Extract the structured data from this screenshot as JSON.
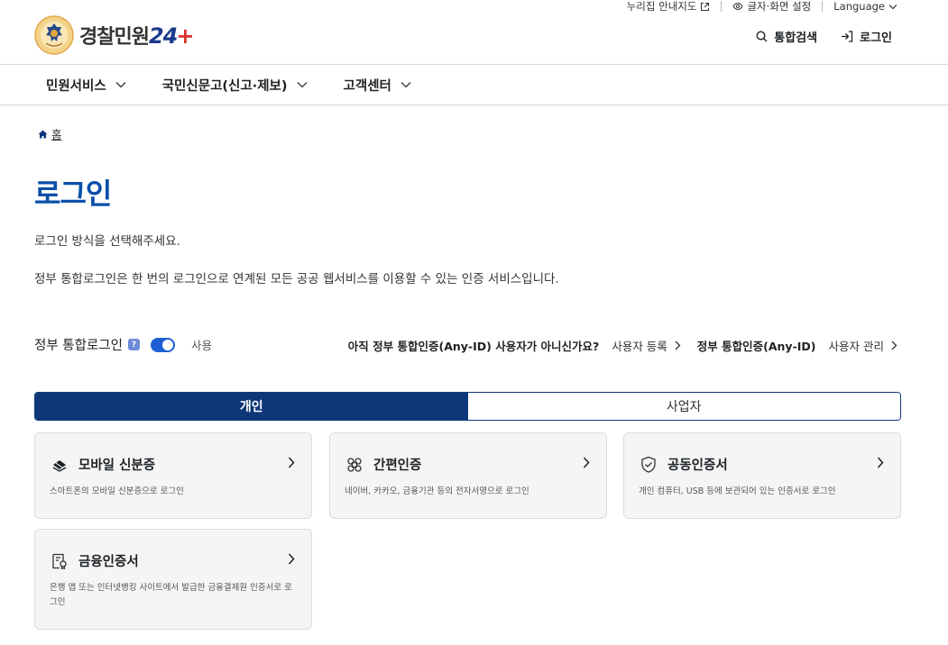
{
  "util": {
    "sitemap": "누리집 안내지도",
    "display": "글자·화면 설정",
    "language": "Language"
  },
  "header": {
    "logo_text": "경찰민원",
    "logo_num": "24",
    "search": "통합검색",
    "login": "로그인"
  },
  "gnb": [
    "민원서비스",
    "국민신문고(신고·제보)",
    "고객센터"
  ],
  "breadcrumb": {
    "home": "홈"
  },
  "page": {
    "title": "로그인",
    "desc1": "로그인 방식을 선택해주세요.",
    "desc2": "정부 통합로그인은 한 번의 로그인으로 연계된 모든 공공 웹서비스를 이용할 수 있는 인증 서비스입니다."
  },
  "integ": {
    "label": "정부 통합로그인",
    "help": "?",
    "toggle_label": "사용",
    "question": "아직 정부 통합인증(Any-ID) 사용자가 아니신가요?",
    "register": "사용자 등록",
    "anyid": "정부 통합인증(Any-ID)",
    "manage": "사용자 관리"
  },
  "tabs": {
    "personal": "개인",
    "business": "사업자"
  },
  "cards": [
    {
      "title": "모바일 신분증",
      "desc": "스마트폰의 모바일 신분증으로 로그인",
      "icon": "mobile-id-icon"
    },
    {
      "title": "간편인증",
      "desc": "네이버, 카카오, 금융기관 등의 전자서명으로 로그인",
      "icon": "simple-auth-icon"
    },
    {
      "title": "공동인증서",
      "desc": "개인 컴퓨터, USB 등에 보관되어 있는 인증서로 로그인",
      "icon": "shield-icon"
    },
    {
      "title": "금융인증서",
      "desc": "은행 앱 또는 인터넷뱅킹 사이트에서 발급한 금융결제원 인증서로 로그인",
      "icon": "certificate-icon"
    }
  ],
  "colors": {
    "brand": "#0d3778",
    "title": "#0a4fa8",
    "toggle": "#1d5fd4"
  }
}
